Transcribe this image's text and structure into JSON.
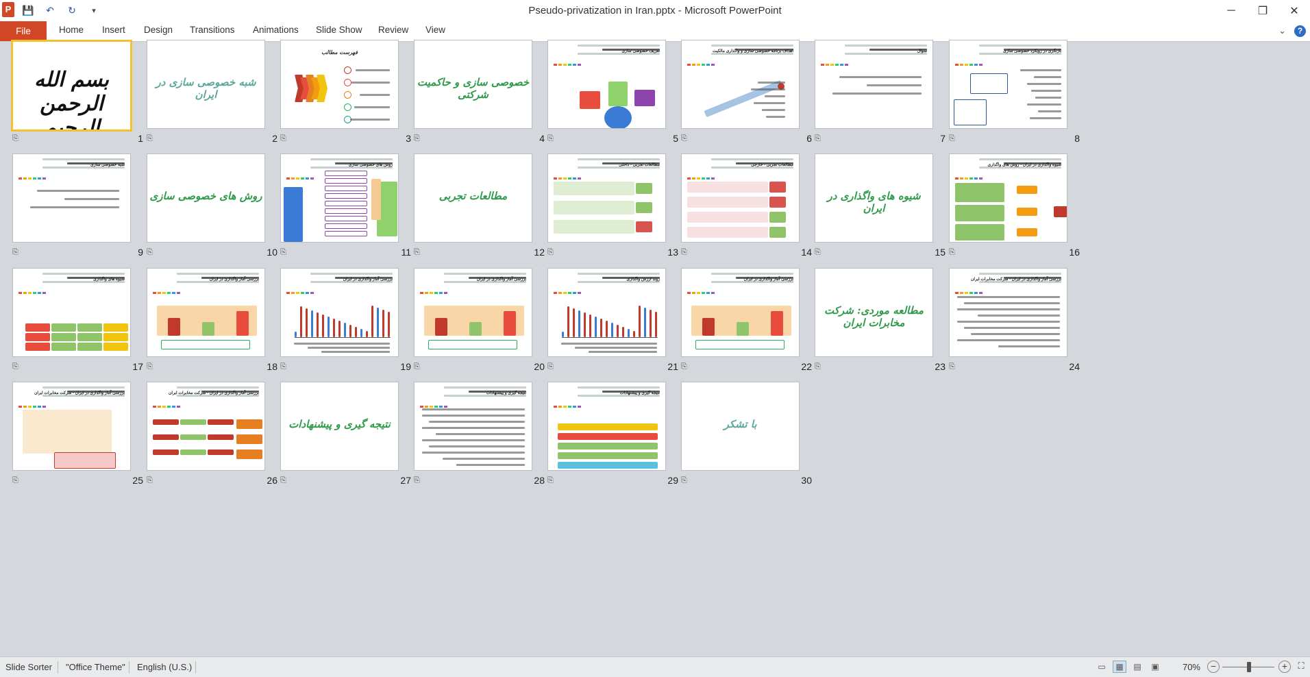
{
  "window": {
    "title": "Pseudo-privatization in Iran.pptx - Microsoft PowerPoint",
    "app_icon_letter": "P",
    "minimize": "─",
    "maximize": "❐",
    "close": "✕"
  },
  "quick_access": {
    "save": "💾",
    "undo": "↶",
    "redo": "↻",
    "customize": "▾"
  },
  "ribbon": {
    "file": "File",
    "tabs": [
      "Home",
      "Insert",
      "Design",
      "Transitions",
      "Animations",
      "Slide Show",
      "Review",
      "View"
    ],
    "collapse": "⌄",
    "help": "?"
  },
  "slides": [
    {
      "num": "1",
      "kind": "basmala",
      "text": "بسم الله الرحمن الرحیم"
    },
    {
      "num": "2",
      "kind": "title",
      "text": "شبه خصوصی سازی در ایران",
      "color": "#5aa89a"
    },
    {
      "num": "3",
      "kind": "toc",
      "text": "فهرست مطالب"
    },
    {
      "num": "4",
      "kind": "title",
      "text": "خصوصی سازی و حاکمیت شرکتی",
      "color": "#2e9a4a"
    },
    {
      "num": "5",
      "kind": "diagram",
      "text": "تعریف خصوصی سازی"
    },
    {
      "num": "6",
      "kind": "arrow",
      "text": "اهداف برنامه خصوصی سازی و واگذاری مالکیت"
    },
    {
      "num": "7",
      "kind": "text",
      "text": "سوال"
    },
    {
      "num": "8",
      "kind": "boxes",
      "text": "بازنگری در رویکرد خصوصی سازی"
    },
    {
      "num": "9",
      "kind": "text",
      "text": "شبه خصوصی سازی"
    },
    {
      "num": "10",
      "kind": "title",
      "text": "روش های خصوصی سازی",
      "color": "#2e9a4a"
    },
    {
      "num": "11",
      "kind": "methods",
      "text": "روش های خصوصی سازی"
    },
    {
      "num": "12",
      "kind": "title",
      "text": "مطالعات تجربی",
      "color": "#2e9a4a"
    },
    {
      "num": "13",
      "kind": "list",
      "text": "مطالعات تجربی - داخلی"
    },
    {
      "num": "14",
      "kind": "list2",
      "text": "مطالعات تجربی - خارجی"
    },
    {
      "num": "15",
      "kind": "title",
      "text": "شیوه های واگذاری در ایران",
      "color": "#2e9a4a"
    },
    {
      "num": "16",
      "kind": "tree",
      "text": "شیوه واگذاری در ایران - روش های واگذاری"
    },
    {
      "num": "17",
      "kind": "table",
      "text": "شیوه های واگذاری"
    },
    {
      "num": "18",
      "kind": "chart",
      "text": "بررسی آمار واگذاری در ایران"
    },
    {
      "num": "19",
      "kind": "bars",
      "text": "بررسی آمار واگذاری در ایران"
    },
    {
      "num": "20",
      "kind": "chart2",
      "text": "بررسی آمار واگذاری در ایران"
    },
    {
      "num": "21",
      "kind": "bars",
      "text": "روند ارزش واگذاری"
    },
    {
      "num": "22",
      "kind": "chart3",
      "text": "بررسی آمار واگذاری در ایران"
    },
    {
      "num": "23",
      "kind": "title",
      "text": "مطالعه موردی: شرکت مخابرات ایران",
      "color": "#2e9a4a"
    },
    {
      "num": "24",
      "kind": "text2",
      "text": "بررسی آمار واگذاری در ایران - شرکت مخابرات ایران"
    },
    {
      "num": "25",
      "kind": "line",
      "text": "بررسی آمار واگذاری در ایران - شرکت مخابرات ایران"
    },
    {
      "num": "26",
      "kind": "table2",
      "text": "بررسی آمار واگذاری در ایران - شرکت مخابرات ایران"
    },
    {
      "num": "27",
      "kind": "title",
      "text": "نتیجه گیری و پیشنهادات",
      "color": "#2e9a4a"
    },
    {
      "num": "28",
      "kind": "text3",
      "text": "نتیجه گیری و پیشنهادات"
    },
    {
      "num": "29",
      "kind": "bands",
      "text": "نتیجه گیری و پیشنهادات"
    },
    {
      "num": "30",
      "kind": "title",
      "text": "با تشکر",
      "color": "#5aa89a"
    }
  ],
  "status": {
    "view_name": "Slide Sorter",
    "theme": "\"Office Theme\"",
    "language": "English (U.S.)",
    "zoom": "70%",
    "zoom_out": "−",
    "zoom_in": "+",
    "fit": "⛶"
  }
}
